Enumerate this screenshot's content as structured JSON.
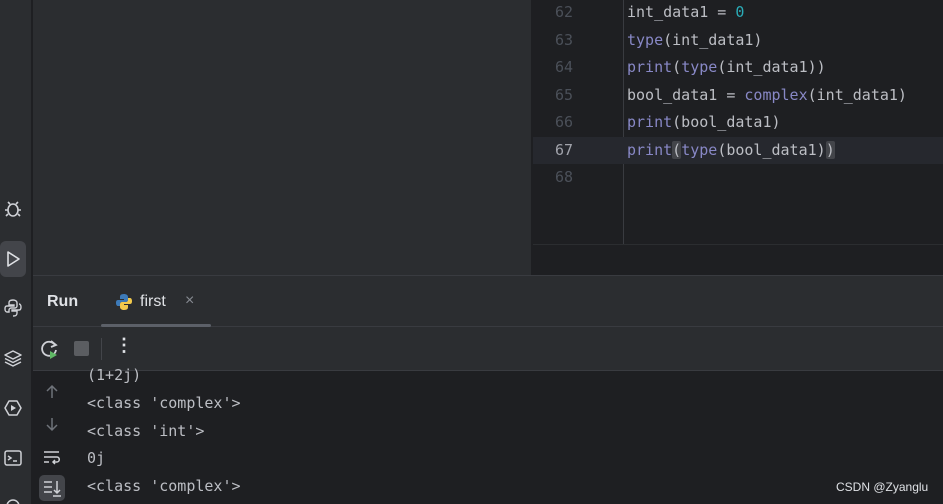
{
  "editor": {
    "lines": [
      {
        "number": "62",
        "tokens": [
          {
            "text": "int_data1 = ",
            "cls": ""
          },
          {
            "text": "0",
            "cls": "num"
          }
        ]
      },
      {
        "number": "63",
        "tokens": [
          {
            "text": "type",
            "cls": "fn"
          },
          {
            "text": "(int_data1)",
            "cls": ""
          }
        ]
      },
      {
        "number": "64",
        "tokens": [
          {
            "text": "print",
            "cls": "fn"
          },
          {
            "text": "(",
            "cls": ""
          },
          {
            "text": "type",
            "cls": "fn"
          },
          {
            "text": "(int_data1))",
            "cls": ""
          }
        ]
      },
      {
        "number": "65",
        "tokens": [
          {
            "text": "bool_data1 = ",
            "cls": ""
          },
          {
            "text": "complex",
            "cls": "fn"
          },
          {
            "text": "(int_data1)",
            "cls": ""
          }
        ]
      },
      {
        "number": "66",
        "tokens": [
          {
            "text": "print",
            "cls": "fn"
          },
          {
            "text": "(bool_data1)",
            "cls": ""
          }
        ]
      },
      {
        "number": "67",
        "current": true,
        "tokens": [
          {
            "text": "print",
            "cls": "fn"
          },
          {
            "text": "(",
            "cls": "hl"
          },
          {
            "text": "type",
            "cls": "fn"
          },
          {
            "text": "(bool_data1)",
            "cls": ""
          },
          {
            "text": ")",
            "cls": "hl"
          }
        ]
      },
      {
        "number": "68",
        "tokens": []
      }
    ]
  },
  "run_panel": {
    "title": "Run",
    "tab_label": "first",
    "tab_close": "×",
    "more_label": "⋮"
  },
  "console": {
    "lines": [
      "(1+2j)",
      "<class 'complex'>",
      "<class 'int'>",
      "0j",
      "<class 'complex'>"
    ]
  },
  "left_toolbar": {
    "icons": [
      "debug-icon",
      "run-icon",
      "python-console-icon",
      "layers-icon",
      "services-icon",
      "terminal-icon"
    ]
  },
  "watermark": "CSDN @Zyanglu",
  "colors": {
    "background": "#1e1f22",
    "panel": "#2b2d30",
    "keyword_builtin": "#8888c6",
    "number": "#2aacb8"
  }
}
